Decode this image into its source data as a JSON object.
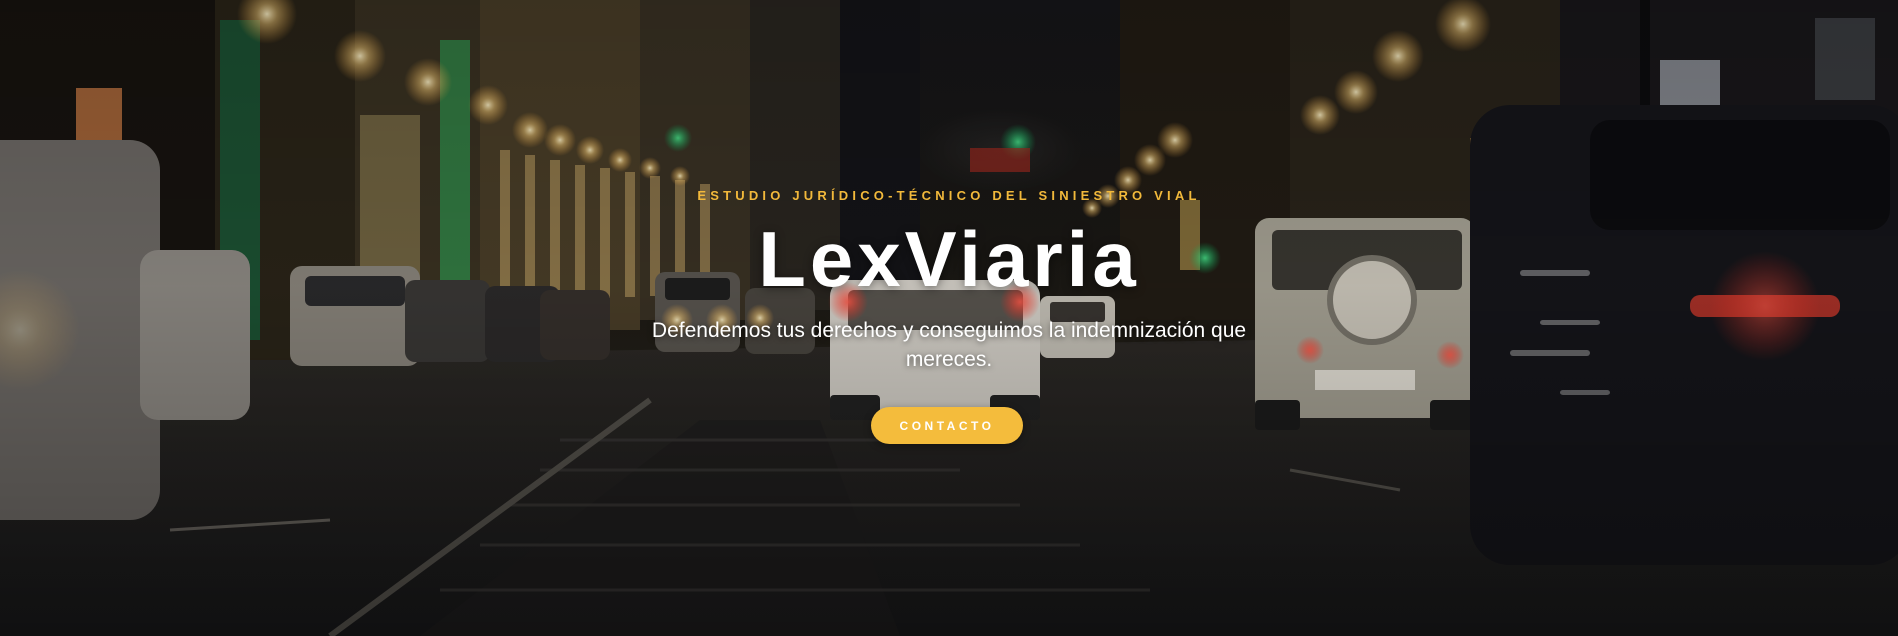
{
  "hero": {
    "eyebrow": "ESTUDIO JURÍDICO-TÉCNICO DEL SINIESTRO VIAL",
    "title": "LexViaria",
    "subtitle": "Defendemos tus derechos y conseguimos la indemnización que mereces.",
    "cta_label": "CONTACTO"
  },
  "colors": {
    "accent": "#f4bc3c",
    "eyebrow": "#f2b93b",
    "text": "#ffffff"
  }
}
